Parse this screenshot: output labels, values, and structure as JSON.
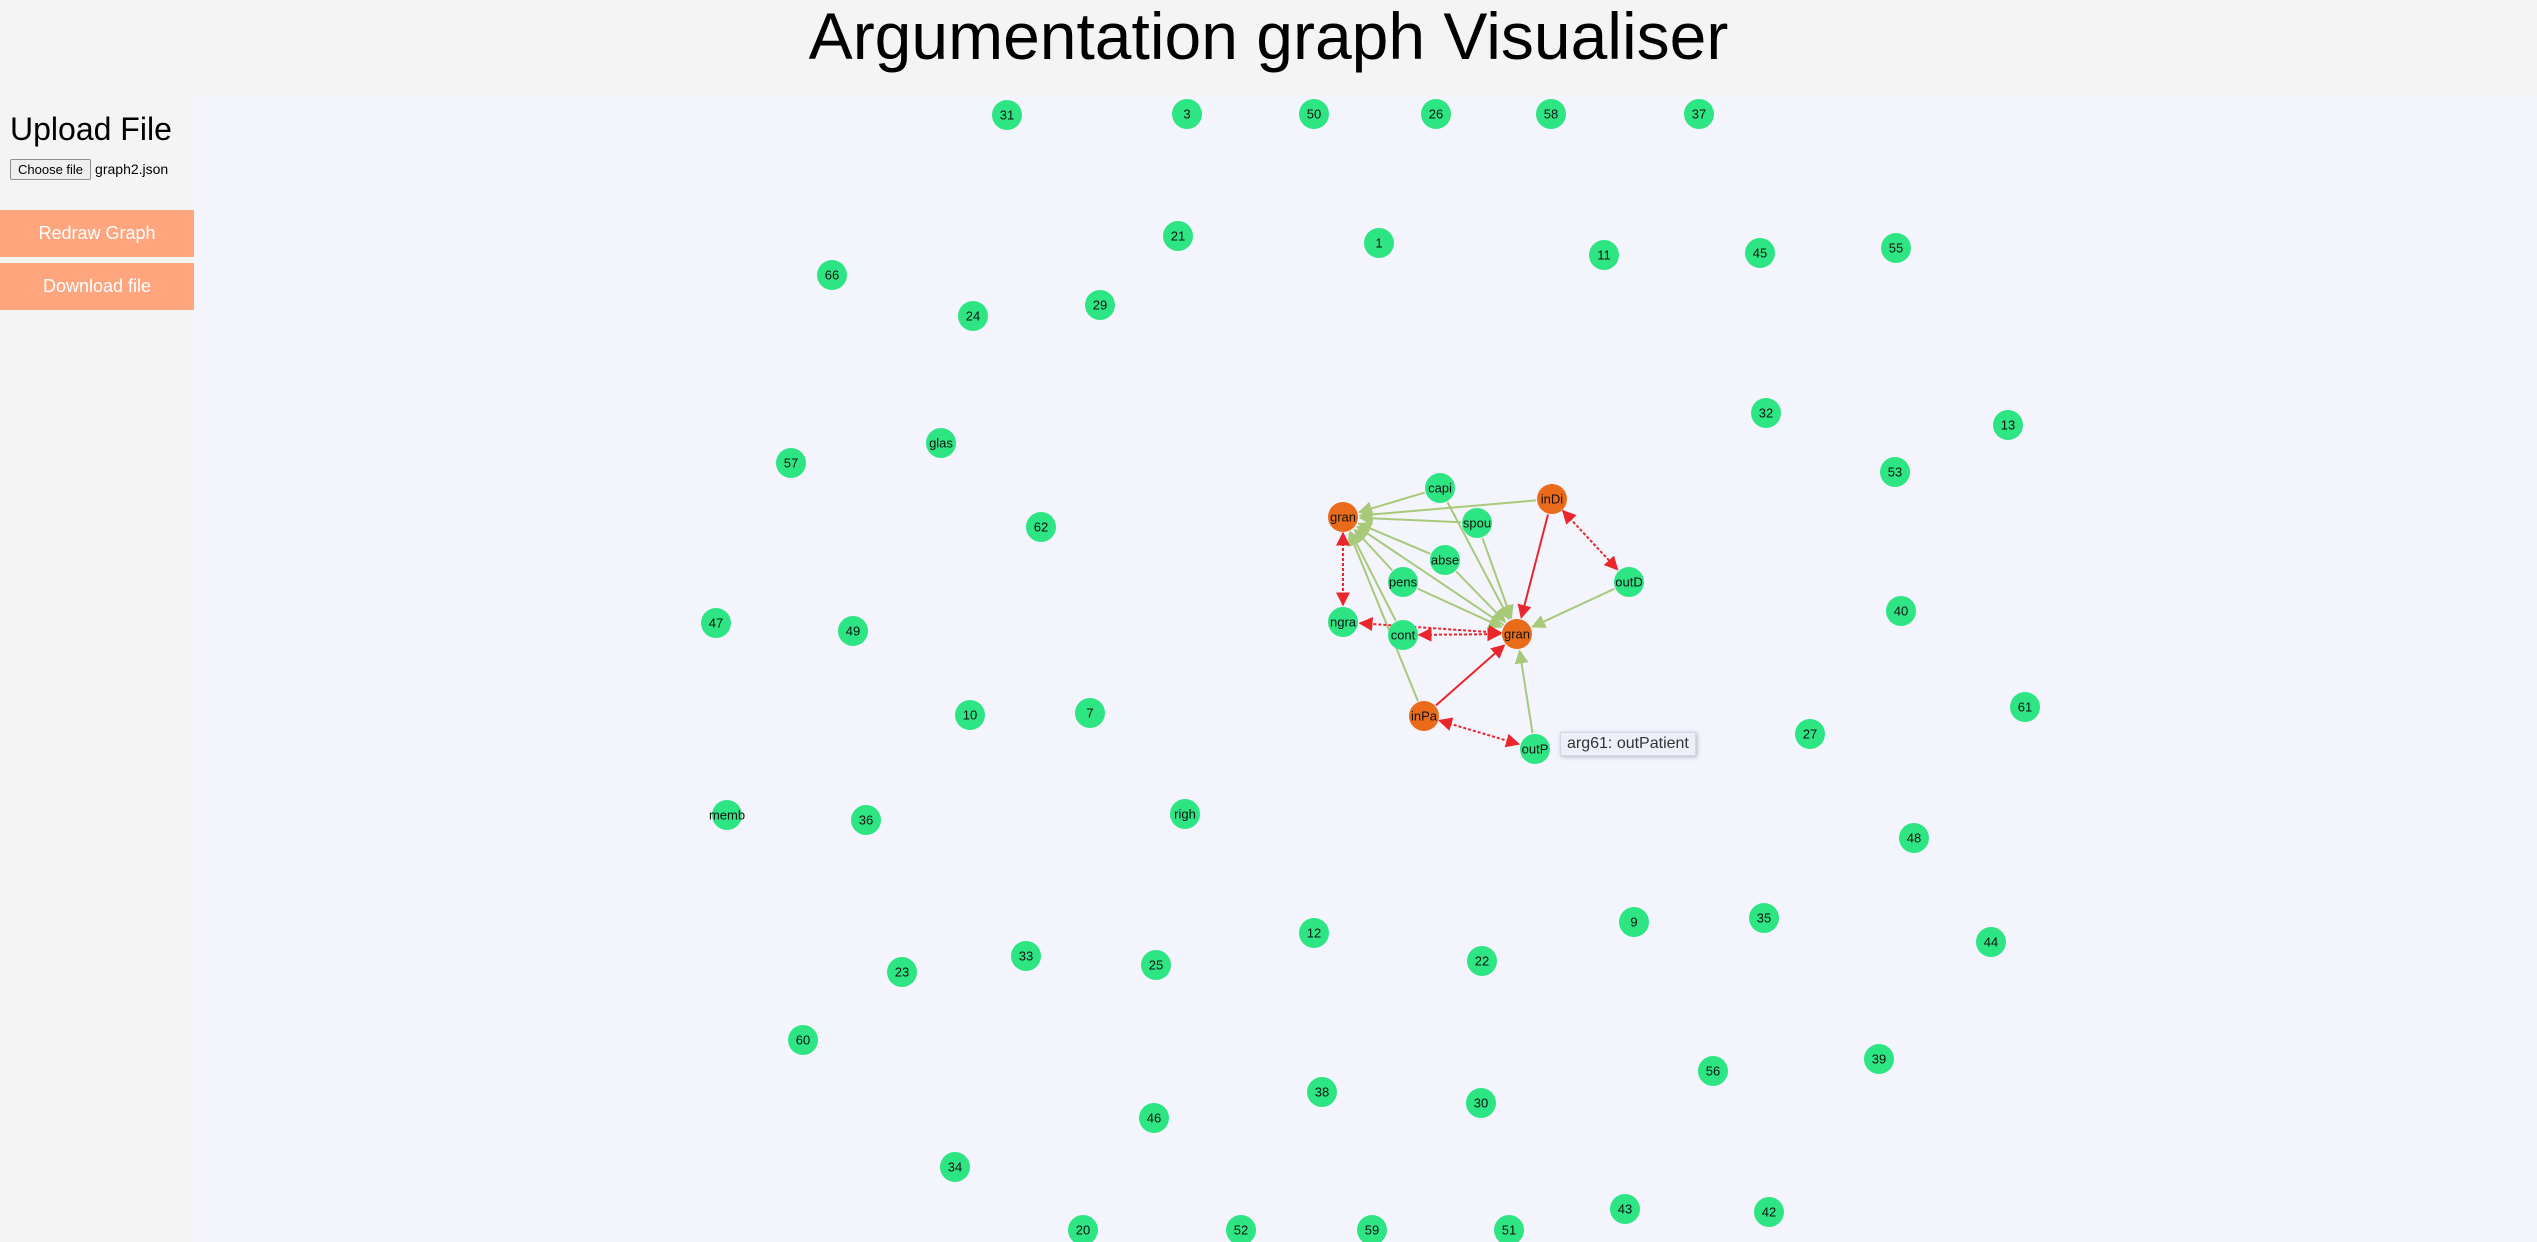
{
  "header": {
    "title": "Argumentation graph Visualiser"
  },
  "sidebar": {
    "upload_heading": "Upload File",
    "choose_file_label": "Choose file",
    "file_name": "graph2.json",
    "redraw_label": "Redraw Graph",
    "download_label": "Download file"
  },
  "tooltip": {
    "text": "arg61: outPatient",
    "anchor_node": "outP"
  },
  "colors": {
    "argument_node": "#2ee584",
    "highlight_node": "#ea6c1a",
    "support_edge": "#a8c97a",
    "attack_edge": "#e8262b",
    "canvas_bg": "#f3f4fc",
    "button_bg": "#ffa57e"
  },
  "graph": {
    "nodes": [
      {
        "id": "31",
        "label": "31",
        "type": "arg"
      },
      {
        "id": "3",
        "label": "3",
        "type": "arg"
      },
      {
        "id": "50",
        "label": "50",
        "type": "arg"
      },
      {
        "id": "26",
        "label": "26",
        "type": "arg"
      },
      {
        "id": "58",
        "label": "58",
        "type": "arg"
      },
      {
        "id": "37",
        "label": "37",
        "type": "arg"
      },
      {
        "id": "21",
        "label": "21",
        "type": "arg"
      },
      {
        "id": "1",
        "label": "1",
        "type": "arg"
      },
      {
        "id": "11",
        "label": "11",
        "type": "arg"
      },
      {
        "id": "45",
        "label": "45",
        "type": "arg"
      },
      {
        "id": "55",
        "label": "55",
        "type": "arg"
      },
      {
        "id": "66",
        "label": "66",
        "type": "arg"
      },
      {
        "id": "24",
        "label": "24",
        "type": "arg"
      },
      {
        "id": "29",
        "label": "29",
        "type": "arg"
      },
      {
        "id": "32",
        "label": "32",
        "type": "arg"
      },
      {
        "id": "13",
        "label": "13",
        "type": "arg"
      },
      {
        "id": "glas",
        "label": "glas",
        "type": "arg"
      },
      {
        "id": "57",
        "label": "57",
        "type": "arg"
      },
      {
        "id": "53",
        "label": "53",
        "type": "arg"
      },
      {
        "id": "62",
        "label": "62",
        "type": "arg"
      },
      {
        "id": "capi",
        "label": "capi",
        "type": "arg"
      },
      {
        "id": "gran1",
        "label": "gran",
        "type": "highlight"
      },
      {
        "id": "spou",
        "label": "spou",
        "type": "arg"
      },
      {
        "id": "inDi",
        "label": "inDi",
        "type": "highlight"
      },
      {
        "id": "abse",
        "label": "abse",
        "type": "arg"
      },
      {
        "id": "pens",
        "label": "pens",
        "type": "arg"
      },
      {
        "id": "outD",
        "label": "outD",
        "type": "arg"
      },
      {
        "id": "47",
        "label": "47",
        "type": "arg"
      },
      {
        "id": "49",
        "label": "49",
        "type": "arg"
      },
      {
        "id": "ngra",
        "label": "ngra",
        "type": "arg"
      },
      {
        "id": "cont",
        "label": "cont",
        "type": "arg"
      },
      {
        "id": "gran2",
        "label": "gran",
        "type": "highlight"
      },
      {
        "id": "40",
        "label": "40",
        "type": "arg"
      },
      {
        "id": "10",
        "label": "10",
        "type": "arg"
      },
      {
        "id": "7",
        "label": "7",
        "type": "arg"
      },
      {
        "id": "inPa",
        "label": "inPa",
        "type": "highlight"
      },
      {
        "id": "61",
        "label": "61",
        "type": "arg"
      },
      {
        "id": "outP",
        "label": "outP",
        "type": "arg"
      },
      {
        "id": "27",
        "label": "27",
        "type": "arg"
      },
      {
        "id": "memb",
        "label": "memb",
        "type": "arg"
      },
      {
        "id": "36",
        "label": "36",
        "type": "arg"
      },
      {
        "id": "righ",
        "label": "righ",
        "type": "arg"
      },
      {
        "id": "48",
        "label": "48",
        "type": "arg"
      },
      {
        "id": "9",
        "label": "9",
        "type": "arg"
      },
      {
        "id": "35",
        "label": "35",
        "type": "arg"
      },
      {
        "id": "12",
        "label": "12",
        "type": "arg"
      },
      {
        "id": "22",
        "label": "22",
        "type": "arg"
      },
      {
        "id": "44",
        "label": "44",
        "type": "arg"
      },
      {
        "id": "23",
        "label": "23",
        "type": "arg"
      },
      {
        "id": "33",
        "label": "33",
        "type": "arg"
      },
      {
        "id": "25",
        "label": "25",
        "type": "arg"
      },
      {
        "id": "60",
        "label": "60",
        "type": "arg"
      },
      {
        "id": "56",
        "label": "56",
        "type": "arg"
      },
      {
        "id": "39",
        "label": "39",
        "type": "arg"
      },
      {
        "id": "38",
        "label": "38",
        "type": "arg"
      },
      {
        "id": "30",
        "label": "30",
        "type": "arg"
      },
      {
        "id": "46",
        "label": "46",
        "type": "arg"
      },
      {
        "id": "34",
        "label": "34",
        "type": "arg"
      },
      {
        "id": "43",
        "label": "43",
        "type": "arg"
      },
      {
        "id": "42",
        "label": "42",
        "type": "arg"
      },
      {
        "id": "20",
        "label": "20",
        "type": "arg"
      },
      {
        "id": "52",
        "label": "52",
        "type": "arg"
      },
      {
        "id": "59",
        "label": "59",
        "type": "arg"
      },
      {
        "id": "51",
        "label": "51",
        "type": "arg"
      }
    ],
    "edges": [
      {
        "from": "capi",
        "to": "gran1",
        "kind": "support"
      },
      {
        "from": "spou",
        "to": "gran1",
        "kind": "support"
      },
      {
        "from": "inDi",
        "to": "gran1",
        "kind": "support"
      },
      {
        "from": "abse",
        "to": "gran1",
        "kind": "support"
      },
      {
        "from": "pens",
        "to": "gran1",
        "kind": "support"
      },
      {
        "from": "cont",
        "to": "gran1",
        "kind": "support"
      },
      {
        "from": "gran2",
        "to": "gran1",
        "kind": "support"
      },
      {
        "from": "inPa",
        "to": "gran1",
        "kind": "support"
      },
      {
        "from": "capi",
        "to": "gran2",
        "kind": "support"
      },
      {
        "from": "spou",
        "to": "gran2",
        "kind": "support"
      },
      {
        "from": "abse",
        "to": "gran2",
        "kind": "support"
      },
      {
        "from": "pens",
        "to": "gran2",
        "kind": "support"
      },
      {
        "from": "outD",
        "to": "gran2",
        "kind": "support"
      },
      {
        "from": "outP",
        "to": "gran2",
        "kind": "support"
      },
      {
        "from": "inDi",
        "to": "gran2",
        "kind": "attack"
      },
      {
        "from": "inPa",
        "to": "gran2",
        "kind": "attack"
      },
      {
        "from": "gran1",
        "to": "ngra",
        "kind": "mutual-attack"
      },
      {
        "from": "gran2",
        "to": "ngra",
        "kind": "mutual-attack"
      },
      {
        "from": "cont",
        "to": "gran2",
        "kind": "mutual-attack"
      },
      {
        "from": "inDi",
        "to": "outD",
        "kind": "mutual-attack"
      },
      {
        "from": "inPa",
        "to": "outP",
        "kind": "mutual-attack"
      }
    ]
  }
}
